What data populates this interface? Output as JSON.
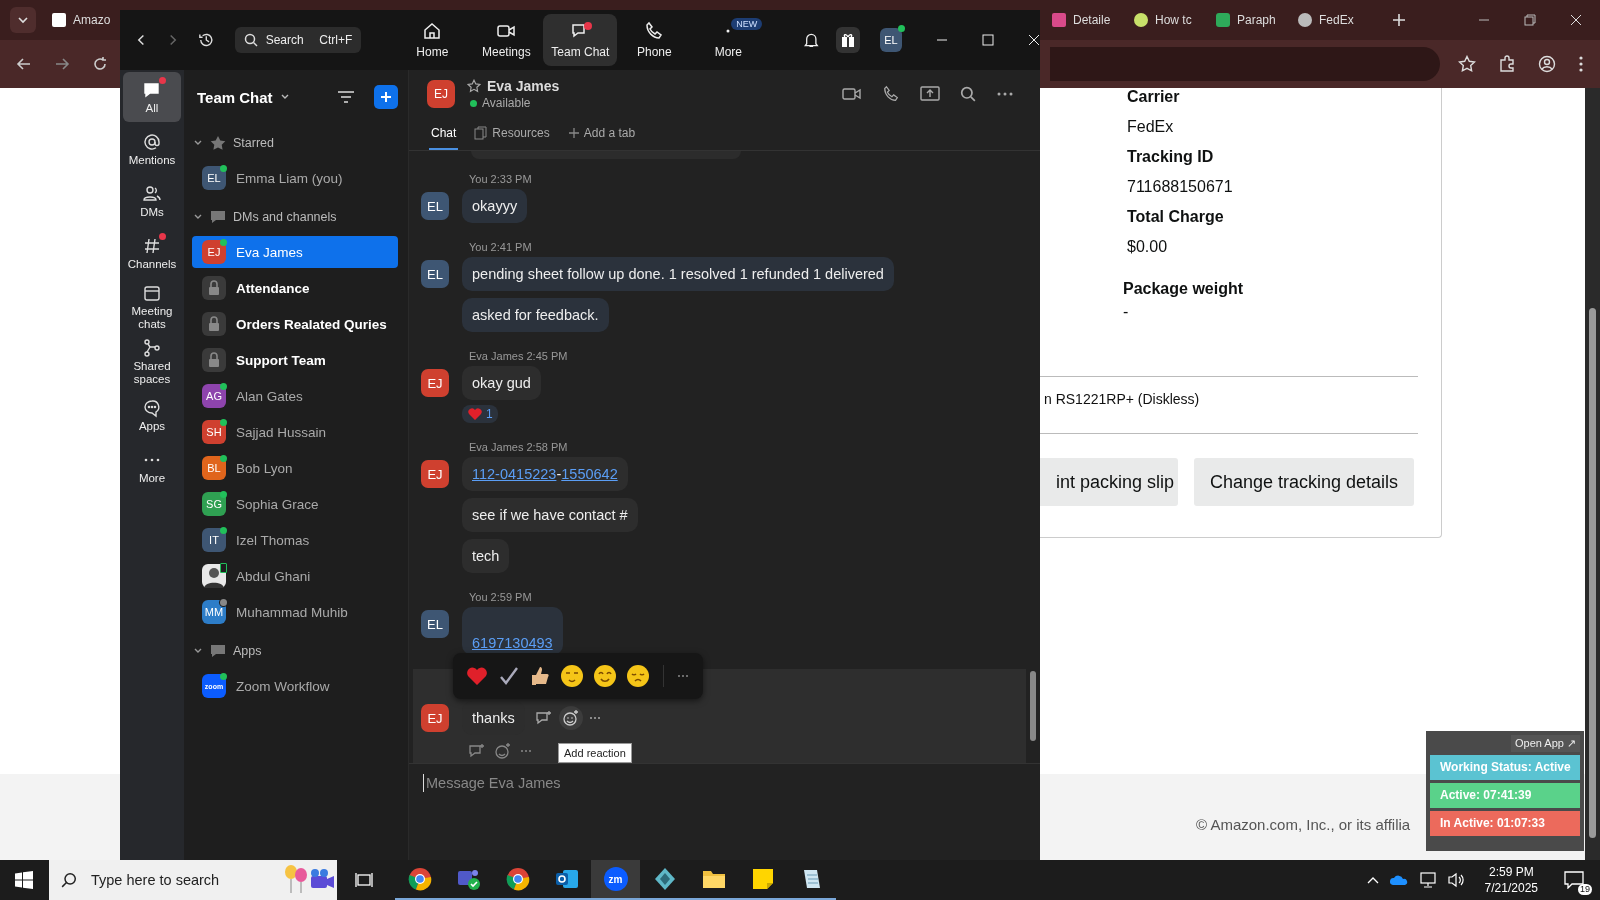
{
  "browser": {
    "tabs": [
      {
        "label": "Amazo"
      },
      {
        "label": "Detaile"
      },
      {
        "label": "How tc"
      },
      {
        "label": "Paraph"
      },
      {
        "label": "FedEx"
      }
    ]
  },
  "page": {
    "fields": [
      {
        "label": "Carrier",
        "value": "FedEx"
      },
      {
        "label": "Tracking ID",
        "value": "711688150671"
      },
      {
        "label": "Total Charge",
        "value": "$0.00"
      }
    ],
    "weight": {
      "label": "Package weight",
      "value": "-"
    },
    "item_text": "n RS1221RP+ (Diskless)",
    "buttons": [
      "int packing slip",
      "Change tracking details"
    ],
    "footer": "© Amazon.com, Inc., or its affilia"
  },
  "tracker": {
    "open_app": "Open App ↗",
    "rows": [
      {
        "text": "Working Status: Active",
        "color": "#5bc3d2"
      },
      {
        "text": "Active: 07:41:39",
        "color": "#5ad28a"
      },
      {
        "text": "In Active: 01:07:33",
        "color": "#ec6a5c"
      }
    ]
  },
  "zoom": {
    "search": {
      "placeholder": "Search",
      "shortcut": "Ctrl+F"
    },
    "nav": [
      {
        "kind": "home",
        "label": "Home",
        "selected": false,
        "badge": false
      },
      {
        "kind": "meetings",
        "label": "Meetings",
        "selected": false,
        "badge": false
      },
      {
        "kind": "chat",
        "label": "Team Chat",
        "selected": true,
        "badge": true
      },
      {
        "kind": "phone",
        "label": "Phone",
        "selected": false,
        "badge": false
      },
      {
        "kind": "more",
        "label": "More",
        "selected": false,
        "badge": false,
        "tag": "NEW"
      }
    ],
    "user": "EL",
    "rail": [
      {
        "kind": "all",
        "label": "All",
        "selected": true,
        "badge": true
      },
      {
        "kind": "mentions",
        "label": "Mentions",
        "selected": false,
        "badge": false
      },
      {
        "kind": "dms",
        "label": "DMs",
        "selected": false,
        "badge": false
      },
      {
        "kind": "channels",
        "label": "Channels",
        "selected": false,
        "badge": true
      },
      {
        "kind": "meeting",
        "label": "Meeting chats",
        "selected": false,
        "badge": false
      },
      {
        "kind": "shared",
        "label": "Shared spaces",
        "selected": false,
        "badge": false
      },
      {
        "kind": "apps",
        "label": "Apps",
        "selected": false,
        "badge": false
      },
      {
        "kind": "more",
        "label": "More",
        "selected": false,
        "badge": false
      }
    ],
    "sidebar": {
      "title": "Team Chat",
      "sections": [
        {
          "title": "Starred",
          "kind": "star",
          "expanded": true,
          "items": [
            {
              "kind": "person",
              "initials": "EL",
              "name": "Emma Liam (you)",
              "color": "#3e5673",
              "online": true,
              "away": false,
              "mobile": false,
              "selected": false,
              "unread": false
            }
          ]
        },
        {
          "title": "DMs and channels",
          "kind": "chat",
          "expanded": true,
          "items": [
            {
              "kind": "person",
              "initials": "EJ",
              "name": "Eva James",
              "color": "#cf402f",
              "online": true,
              "away": false,
              "mobile": false,
              "selected": true,
              "unread": false
            },
            {
              "kind": "channel",
              "name": "Attendance",
              "selected": false,
              "unread": true
            },
            {
              "kind": "channel",
              "name": "Orders Realated Quries",
              "selected": false,
              "unread": true
            },
            {
              "kind": "channel",
              "name": "Support Team",
              "selected": false,
              "unread": true
            },
            {
              "kind": "person",
              "initials": "AG",
              "name": "Alan Gates",
              "color": "#8e44ad",
              "online": true,
              "away": false,
              "mobile": false,
              "selected": false,
              "unread": false
            },
            {
              "kind": "person",
              "initials": "SH",
              "name": "Sajjad Hussain",
              "color": "#cf402f",
              "online": true,
              "away": false,
              "mobile": false,
              "selected": false,
              "unread": false
            },
            {
              "kind": "person",
              "initials": "BL",
              "name": "Bob Lyon",
              "color": "#e0651c",
              "online": true,
              "away": false,
              "mobile": false,
              "selected": false,
              "unread": false
            },
            {
              "kind": "person",
              "initials": "SG",
              "name": "Sophia Grace",
              "color": "#2fa052",
              "online": true,
              "away": false,
              "mobile": false,
              "selected": false,
              "unread": false
            },
            {
              "kind": "person",
              "initials": "IT",
              "name": "Izel Thomas",
              "color": "#3e5673",
              "online": true,
              "away": false,
              "mobile": false,
              "selected": false,
              "unread": false
            },
            {
              "kind": "photo",
              "name": "Abdul Ghani",
              "online": false,
              "away": false,
              "mobile": true,
              "selected": false,
              "unread": false
            },
            {
              "kind": "person",
              "initials": "MM",
              "name": "Muhammad Muhib",
              "color": "#2d7dc8",
              "online": false,
              "away": true,
              "mobile": false,
              "selected": false,
              "unread": false
            }
          ]
        },
        {
          "title": "Apps",
          "kind": "chat",
          "expanded": true,
          "items": [
            {
              "kind": "app",
              "initials": "zoom",
              "name": "Zoom Workflow",
              "color": "#0b5cff",
              "online": true,
              "away": false,
              "mobile": false,
              "selected": false,
              "unread": false
            }
          ]
        }
      ]
    },
    "chat": {
      "initials": "EJ",
      "color": "#cf402f",
      "name": "Eva James",
      "presence": "Available",
      "tabs": [
        {
          "kind": "chat",
          "label": "Chat",
          "selected": true
        },
        {
          "kind": "resources",
          "label": "Resources",
          "selected": false
        },
        {
          "kind": "add",
          "label": "Add a tab",
          "selected": false
        }
      ],
      "groups": [
        {
          "sender": "You",
          "time": "2:33 PM",
          "initials": "EL",
          "color": "#3e5673",
          "mine": true,
          "hovered": false,
          "messages": [
            {
              "parts": [
                {
                  "text": "okayyy",
                  "link": false
                }
              ]
            }
          ]
        },
        {
          "sender": "You",
          "time": "2:41 PM",
          "initials": "EL",
          "color": "#3e5673",
          "mine": true,
          "hovered": false,
          "messages": [
            {
              "parts": [
                {
                  "text": "pending sheet follow up done. 1 resolved 1 refunded 1 delivered",
                  "link": false
                }
              ]
            },
            {
              "parts": [
                {
                  "text": "asked for feedback.",
                  "link": false
                }
              ]
            }
          ]
        },
        {
          "sender": "Eva James",
          "time": "2:45 PM",
          "initials": "EJ",
          "color": "#cf402f",
          "mine": false,
          "hovered": false,
          "messages": [
            {
              "parts": [
                {
                  "text": "okay gud",
                  "link": false
                }
              ],
              "reaction": {
                "count": "1"
              }
            }
          ]
        },
        {
          "sender": "Eva James",
          "time": "2:58 PM",
          "initials": "EJ",
          "color": "#cf402f",
          "mine": false,
          "hovered": false,
          "messages": [
            {
              "parts": [
                {
                  "text": "112-0415223",
                  "link": true
                },
                {
                  "text": "-",
                  "link": false
                },
                {
                  "text": "1550642",
                  "link": true
                }
              ]
            },
            {
              "parts": [
                {
                  "text": "see if we have contact #",
                  "link": false
                }
              ]
            },
            {
              "parts": [
                {
                  "text": "tech",
                  "link": false
                }
              ]
            }
          ]
        },
        {
          "sender": "You",
          "time": "2:59 PM",
          "initials": "EL",
          "color": "#3e5673",
          "mine": true,
          "hovered": false,
          "messages": [
            {
              "parts": [
                {
                  "text": "6197130493",
                  "link": true
                }
              ],
              "tall": true
            }
          ]
        },
        {
          "initials": "EJ",
          "color": "#cf402f",
          "mine": false,
          "hovered": true,
          "messages": [
            {
              "parts": [
                {
                  "text": "thanks",
                  "link": false
                }
              ]
            }
          ]
        }
      ],
      "tooltip": "Add reaction",
      "composer": {
        "placeholder": "Message Eva James"
      }
    }
  },
  "taskbar": {
    "search": {
      "placeholder": "Type here to search"
    },
    "apps": [
      {
        "kind": "chrome",
        "selected": false
      },
      {
        "kind": "teams",
        "selected": false
      },
      {
        "kind": "chrome",
        "selected": false
      },
      {
        "kind": "outlook",
        "selected": false
      },
      {
        "kind": "zoom",
        "label": "zm",
        "selected": true
      },
      {
        "kind": "diamond",
        "selected": false
      },
      {
        "kind": "folder",
        "selected": false
      },
      {
        "kind": "sticky",
        "selected": false
      },
      {
        "kind": "notepad",
        "selected": false
      }
    ],
    "time": "2:59 PM",
    "date": "7/21/2025",
    "notifications": "19"
  }
}
